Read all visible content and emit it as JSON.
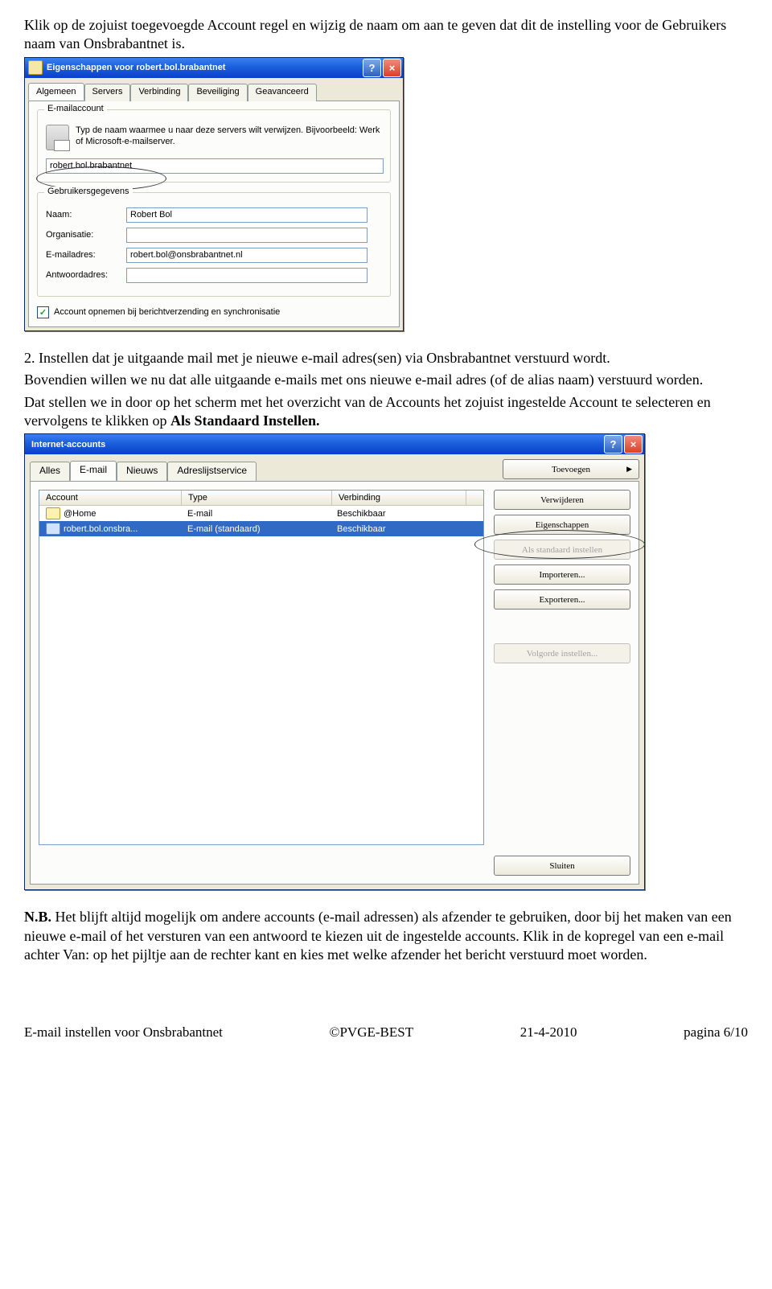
{
  "intro_text": "Klik op de zojuist toegevoegde Account regel en wijzig de naam om aan te geven dat dit de instelling voor de Gebruikers naam van Onsbrabantnet is.",
  "dlg1": {
    "title": "Eigenschappen voor robert.bol.brabantnet",
    "tabs": [
      "Algemeen",
      "Servers",
      "Verbinding",
      "Beveiliging",
      "Geavanceerd"
    ],
    "group1_title": "E-mailaccount",
    "desc": "Typ de naam waarmee u naar deze servers wilt verwijzen. Bijvoorbeeld: Werk of Microsoft-e-mailserver.",
    "account_name": "robert.bol.brabantnet",
    "group2_title": "Gebruikersgegevens",
    "labels": {
      "naam": "Naam:",
      "org": "Organisatie:",
      "email": "E-mailadres:",
      "reply": "Antwoordadres:"
    },
    "values": {
      "naam": "Robert Bol",
      "org": "",
      "email": "robert.bol@onsbrabantnet.nl",
      "reply": ""
    },
    "checkbox": "Account opnemen bij berichtverzending en synchronisatie"
  },
  "mid_para_lead": "2. Instellen dat je uitgaande mail met je nieuwe e-mail adres(sen) via Onsbrabantnet verstuurd wordt.",
  "mid_para_body1": "Bovendien willen we nu dat alle uitgaande e-mails met ons nieuwe e-mail adres (of de alias naam) verstuurd worden.",
  "mid_para_body2a": "Dat stellen we in door op het scherm met het overzicht van de Accounts het zojuist ingestelde Account te selecteren en vervolgens te klikken op ",
  "mid_para_body2b": "Als Standaard Instellen.",
  "dlg2": {
    "title": "Internet-accounts",
    "tabs": [
      "Alles",
      "E-mail",
      "Nieuws",
      "Adreslijstservice"
    ],
    "headers": {
      "acc": "Account",
      "type": "Type",
      "conn": "Verbinding"
    },
    "rows": [
      {
        "acc": "@Home",
        "type": "E-mail",
        "conn": "Beschikbaar",
        "selected": false
      },
      {
        "acc": "robert.bol.onsbra...",
        "type": "E-mail (standaard)",
        "conn": "Beschikbaar",
        "selected": true
      }
    ],
    "buttons": {
      "add": "Toevoegen",
      "remove": "Verwijderen",
      "props": "Eigenschappen",
      "default": "Als standaard instellen",
      "import": "Importeren...",
      "export": "Exporteren...",
      "order": "Volgorde instellen...",
      "close": "Sluiten"
    }
  },
  "nb_label": "N.B.",
  "nb_text": " Het blijft altijd mogelijk om andere accounts (e-mail adressen) als afzender te gebruiken, door bij het maken van een nieuwe e-mail of het versturen van een antwoord te kiezen uit de ingestelde accounts. Klik in de kopregel van een e-mail achter Van: op het pijltje aan de rechter kant en kies met welke afzender het bericht verstuurd moet worden.",
  "footer": {
    "left": "E-mail instellen voor Onsbrabantnet",
    "mid": "©PVGE-BEST",
    "date": "21-4-2010",
    "page": "pagina 6/10"
  }
}
